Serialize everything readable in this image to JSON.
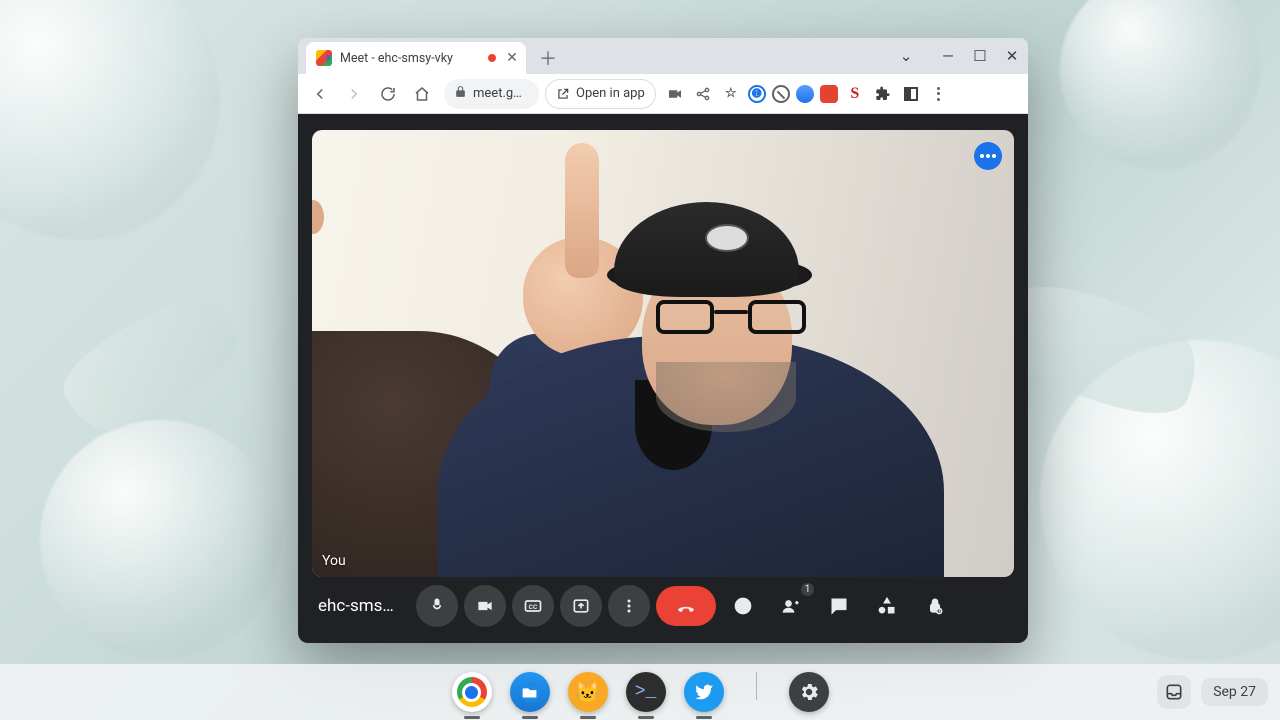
{
  "browser": {
    "tab_title": "Meet - ehc-smsy-vky",
    "url_display": "meet.g…",
    "open_in_app_label": "Open in app"
  },
  "meet": {
    "code_truncated": "ehc-sms…",
    "self_label": "You",
    "participant_count": "1"
  },
  "tray": {
    "date": "Sep 27"
  }
}
